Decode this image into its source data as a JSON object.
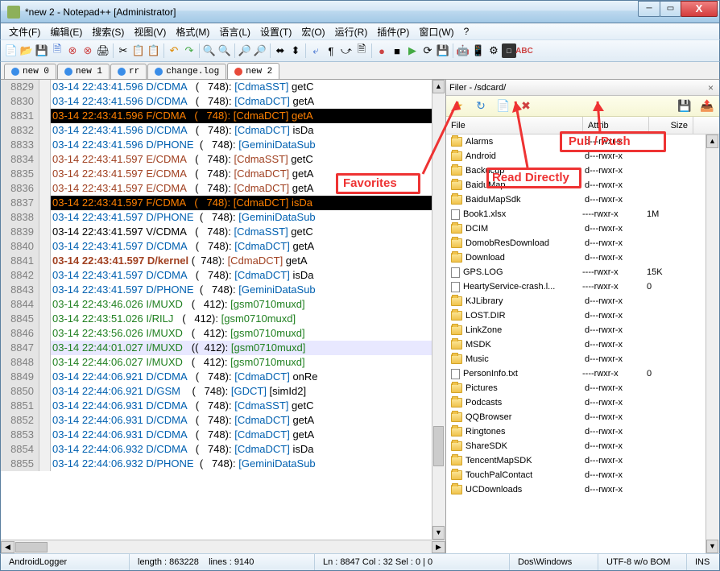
{
  "window": {
    "title": "*new  2 - Notepad++ [Administrator]"
  },
  "menu": [
    "文件(F)",
    "编辑(E)",
    "搜索(S)",
    "视图(V)",
    "格式(M)",
    "语言(L)",
    "设置(T)",
    "宏(O)",
    "运行(R)",
    "插件(P)",
    "窗口(W)",
    "?"
  ],
  "tabs": [
    {
      "label": "new  0",
      "active": false,
      "dirty": false
    },
    {
      "label": "new  1",
      "active": false,
      "dirty": false
    },
    {
      "label": "rr",
      "active": false,
      "dirty": false
    },
    {
      "label": "change.log",
      "active": false,
      "dirty": false
    },
    {
      "label": "new  2",
      "active": true,
      "dirty": true
    }
  ],
  "code": [
    {
      "n": 8829,
      "cls": "d",
      "ts": "03-14 22:43:41.596",
      "lvl": "D/CDMA",
      "pid": "(   748):",
      "tag": "[CdmaSST]",
      "rest": " getC"
    },
    {
      "n": 8830,
      "cls": "d",
      "ts": "03-14 22:43:41.596",
      "lvl": "D/CDMA",
      "pid": "(   748):",
      "tag": "[CdmaDCT]",
      "rest": " getA"
    },
    {
      "n": 8831,
      "cls": "hl",
      "ts": "03-14 22:43:41.596",
      "lvl": "F/CDMA",
      "pid": "(   748):",
      "tag": "[CdmaDCT]",
      "rest": " getA"
    },
    {
      "n": 8832,
      "cls": "d",
      "ts": "03-14 22:43:41.596",
      "lvl": "D/CDMA",
      "pid": "(   748):",
      "tag": "[CdmaDCT]",
      "rest": " isDa"
    },
    {
      "n": 8833,
      "cls": "d",
      "ts": "03-14 22:43:41.596",
      "lvl": "D/PHONE",
      "pid": "(   748):",
      "tag": "[GeminiDataSub",
      "rest": ""
    },
    {
      "n": 8834,
      "cls": "e",
      "ts": "03-14 22:43:41.597",
      "lvl": "E/CDMA",
      "pid": "(   748):",
      "tag": "[CdmaSST]",
      "rest": " getC"
    },
    {
      "n": 8835,
      "cls": "e",
      "ts": "03-14 22:43:41.597",
      "lvl": "E/CDMA",
      "pid": "(   748):",
      "tag": "[CdmaDCT]",
      "rest": " getA"
    },
    {
      "n": 8836,
      "cls": "e",
      "ts": "03-14 22:43:41.597",
      "lvl": "E/CDMA",
      "pid": "(   748):",
      "tag": "[CdmaDCT]",
      "rest": " getA"
    },
    {
      "n": 8837,
      "cls": "hl",
      "ts": "03-14 22:43:41.597",
      "lvl": "F/CDMA",
      "pid": "(   748):",
      "tag": "[CdmaDCT]",
      "rest": " isDa"
    },
    {
      "n": 8838,
      "cls": "d",
      "ts": "03-14 22:43:41.597",
      "lvl": "D/PHONE",
      "pid": "(   748):",
      "tag": "[GeminiDataSub",
      "rest": ""
    },
    {
      "n": 8839,
      "cls": "v",
      "ts": "03-14 22:43:41.597",
      "lvl": "V/CDMA",
      "pid": "(   748):",
      "tag": "[CdmaSST]",
      "rest": " getC"
    },
    {
      "n": 8840,
      "cls": "d",
      "ts": "03-14 22:43:41.597",
      "lvl": "D/CDMA",
      "pid": "(   748):",
      "tag": "[CdmaDCT]",
      "rest": " getA"
    },
    {
      "n": 8841,
      "cls": "k",
      "ts": "03-14 22:43:41.597",
      "lvl": "D/kernel",
      "pid": "(  748):",
      "tag": "[CdmaDCT]",
      "rest": " getA"
    },
    {
      "n": 8842,
      "cls": "d",
      "ts": "03-14 22:43:41.597",
      "lvl": "D/CDMA",
      "pid": "(   748):",
      "tag": "[CdmaDCT]",
      "rest": " isDa"
    },
    {
      "n": 8843,
      "cls": "d",
      "ts": "03-14 22:43:41.597",
      "lvl": "D/PHONE",
      "pid": "(   748):",
      "tag": "[GeminiDataSub",
      "rest": ""
    },
    {
      "n": 8844,
      "cls": "i",
      "ts": "03-14 22:43:46.026",
      "lvl": "I/MUXD",
      "pid": "(   412):",
      "tag": "[gsm0710muxd]",
      "rest": ""
    },
    {
      "n": 8845,
      "cls": "i",
      "ts": "03-14 22:43:51.026",
      "lvl": "I/RILJ",
      "pid": "(   412):",
      "tag": "[gsm0710muxd]",
      "rest": ""
    },
    {
      "n": 8846,
      "cls": "i",
      "ts": "03-14 22:43:56.026",
      "lvl": "I/MUXD",
      "pid": "(   412):",
      "tag": "[gsm0710muxd]",
      "rest": ""
    },
    {
      "n": 8847,
      "cls": "i hl2",
      "ts": "03-14 22:44:01.027",
      "lvl": "I/MUXD",
      "pid": "((  412):",
      "tag": "[gsm0710muxd]",
      "rest": ""
    },
    {
      "n": 8848,
      "cls": "i",
      "ts": "03-14 22:44:06.027",
      "lvl": "I/MUXD",
      "pid": "(   412):",
      "tag": "[gsm0710muxd]",
      "rest": ""
    },
    {
      "n": 8849,
      "cls": "d",
      "ts": "03-14 22:44:06.921",
      "lvl": "D/CDMA",
      "pid": "(   748):",
      "tag": "[CdmaDCT]",
      "rest": " onRe"
    },
    {
      "n": 8850,
      "cls": "d",
      "ts": "03-14 22:44:06.921",
      "lvl": "D/GSM",
      "pid": "(   748):",
      "tag": "[GDCT]",
      "rest": " [simId2]"
    },
    {
      "n": 8851,
      "cls": "d",
      "ts": "03-14 22:44:06.931",
      "lvl": "D/CDMA",
      "pid": "(   748):",
      "tag": "[CdmaSST]",
      "rest": " getC"
    },
    {
      "n": 8852,
      "cls": "d",
      "ts": "03-14 22:44:06.931",
      "lvl": "D/CDMA",
      "pid": "(   748):",
      "tag": "[CdmaDCT]",
      "rest": " getA"
    },
    {
      "n": 8853,
      "cls": "d",
      "ts": "03-14 22:44:06.931",
      "lvl": "D/CDMA",
      "pid": "(   748):",
      "tag": "[CdmaDCT]",
      "rest": " getA"
    },
    {
      "n": 8854,
      "cls": "d",
      "ts": "03-14 22:44:06.932",
      "lvl": "D/CDMA",
      "pid": "(   748):",
      "tag": "[CdmaDCT]",
      "rest": " isDa"
    },
    {
      "n": 8855,
      "cls": "d",
      "ts": "03-14 22:44:06.932",
      "lvl": "D/PHONE",
      "pid": "(   748):",
      "tag": "[GeminiDataSub",
      "rest": ""
    }
  ],
  "filer": {
    "title": "Filer - /sdcard/",
    "columns": {
      "file": "File",
      "attrib": "Attrib",
      "size": "Size"
    },
    "rows": [
      {
        "name": "Alarms",
        "type": "folder",
        "attr": "d---rwxr-x",
        "size": ""
      },
      {
        "name": "Android",
        "type": "folder",
        "attr": "d---rwxr-x",
        "size": ""
      },
      {
        "name": "Backucup",
        "type": "folder",
        "attr": "d---rwxr-x",
        "size": ""
      },
      {
        "name": "BaiduMap",
        "type": "folder",
        "attr": "d---rwxr-x",
        "size": ""
      },
      {
        "name": "BaiduMapSdk",
        "type": "folder",
        "attr": "d---rwxr-x",
        "size": ""
      },
      {
        "name": "Book1.xlsx",
        "type": "file",
        "attr": "----rwxr-x",
        "size": "1M"
      },
      {
        "name": "DCIM",
        "type": "folder",
        "attr": "d---rwxr-x",
        "size": ""
      },
      {
        "name": "DomobResDownload",
        "type": "folder",
        "attr": "d---rwxr-x",
        "size": ""
      },
      {
        "name": "Download",
        "type": "folder",
        "attr": "d---rwxr-x",
        "size": ""
      },
      {
        "name": "GPS.LOG",
        "type": "file",
        "attr": "----rwxr-x",
        "size": "15K"
      },
      {
        "name": "HeartyService-crash.l...",
        "type": "file",
        "attr": "----rwxr-x",
        "size": "0"
      },
      {
        "name": "KJLibrary",
        "type": "folder",
        "attr": "d---rwxr-x",
        "size": ""
      },
      {
        "name": "LOST.DIR",
        "type": "folder",
        "attr": "d---rwxr-x",
        "size": ""
      },
      {
        "name": "LinkZone",
        "type": "folder",
        "attr": "d---rwxr-x",
        "size": ""
      },
      {
        "name": "MSDK",
        "type": "folder",
        "attr": "d---rwxr-x",
        "size": ""
      },
      {
        "name": "Music",
        "type": "folder",
        "attr": "d---rwxr-x",
        "size": ""
      },
      {
        "name": "PersonInfo.txt",
        "type": "file",
        "attr": "----rwxr-x",
        "size": "0"
      },
      {
        "name": "Pictures",
        "type": "folder",
        "attr": "d---rwxr-x",
        "size": ""
      },
      {
        "name": "Podcasts",
        "type": "folder",
        "attr": "d---rwxr-x",
        "size": ""
      },
      {
        "name": "QQBrowser",
        "type": "folder",
        "attr": "d---rwxr-x",
        "size": ""
      },
      {
        "name": "Ringtones",
        "type": "folder",
        "attr": "d---rwxr-x",
        "size": ""
      },
      {
        "name": "ShareSDK",
        "type": "folder",
        "attr": "d---rwxr-x",
        "size": ""
      },
      {
        "name": "TencentMapSDK",
        "type": "folder",
        "attr": "d---rwxr-x",
        "size": ""
      },
      {
        "name": "TouchPalContact",
        "type": "folder",
        "attr": "d---rwxr-x",
        "size": ""
      },
      {
        "name": "UCDownloads",
        "type": "folder",
        "attr": "d---rwxr-x",
        "size": ""
      }
    ]
  },
  "status": {
    "plugin": "AndroidLogger",
    "length": "length : 863228",
    "lines": "lines : 9140",
    "pos": "Ln : 8847    Col : 32    Sel : 0 | 0",
    "eol": "Dos\\Windows",
    "enc": "UTF-8 w/o BOM",
    "ins": "INS"
  },
  "annotations": {
    "favorites": "Favorites",
    "read": "Read Directly",
    "pull": "Pull / Push"
  }
}
